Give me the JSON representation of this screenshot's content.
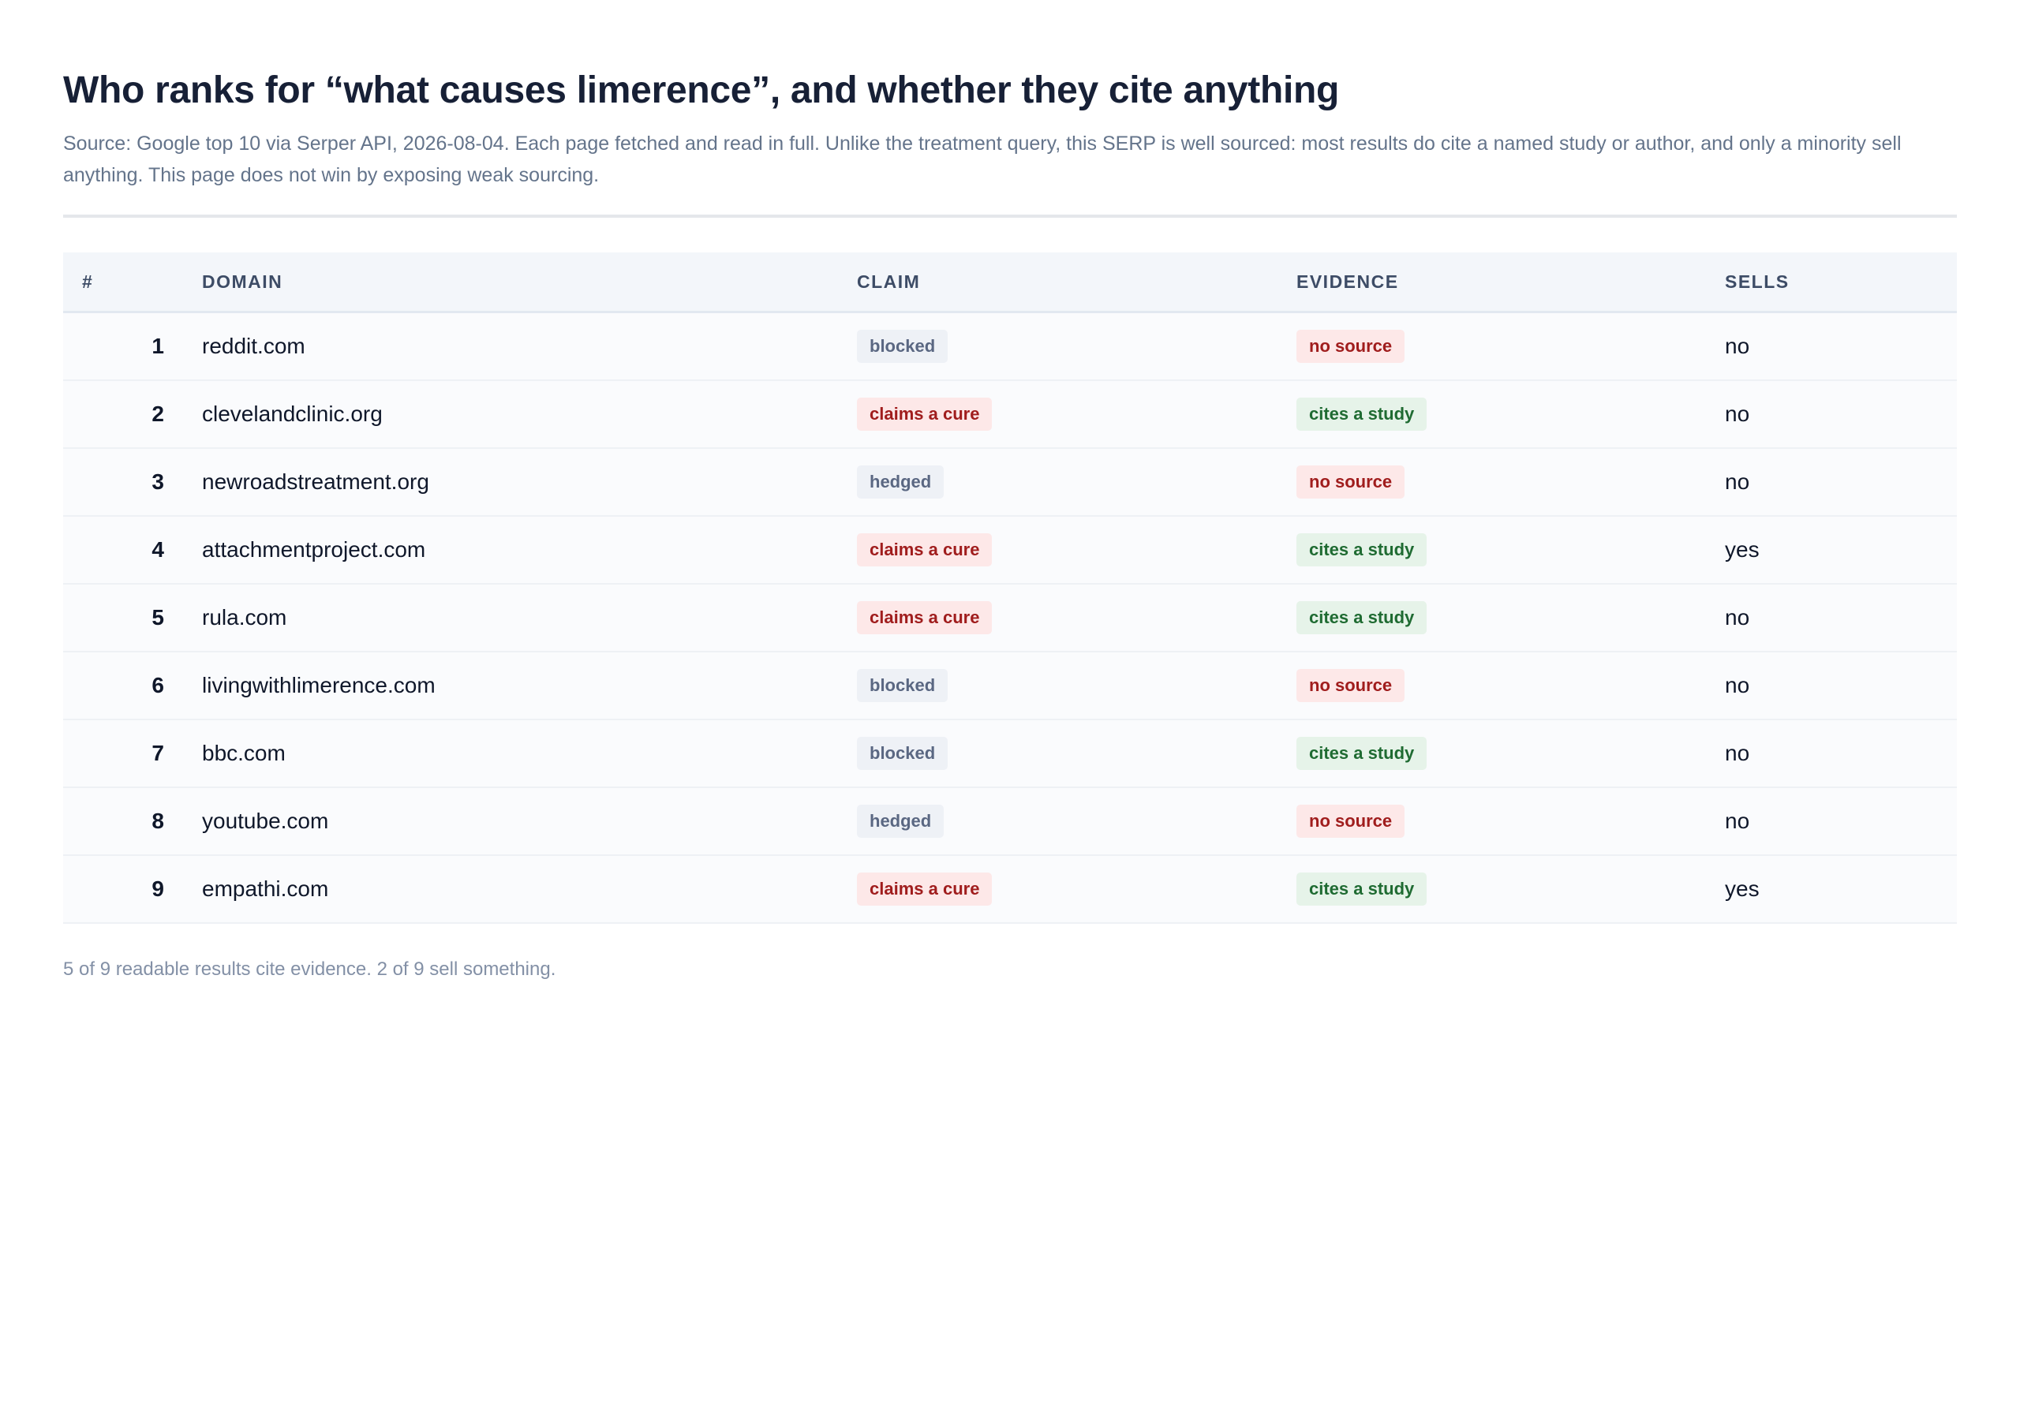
{
  "header": {
    "title": "Who ranks for “what causes limerence”, and whether they cite anything",
    "subtitle": "Source: Google top 10 via Serper API, 2026-08-04. Each page fetched and read in full. Unlike the treatment query, this SERP is well sourced: most results do cite a named study or author, and only a minority sell anything. This page does not win by exposing weak sourcing."
  },
  "table": {
    "columns": [
      "#",
      "Domain",
      "Claim",
      "Evidence",
      "Sells"
    ],
    "rows": [
      {
        "rank": "1",
        "domain": "reddit.com",
        "claim": "blocked",
        "evidence": "no source",
        "sells": "no"
      },
      {
        "rank": "2",
        "domain": "clevelandclinic.org",
        "claim": "claims a cure",
        "evidence": "cites a study",
        "sells": "no"
      },
      {
        "rank": "3",
        "domain": "newroadstreatment.org",
        "claim": "hedged",
        "evidence": "no source",
        "sells": "no"
      },
      {
        "rank": "4",
        "domain": "attachmentproject.com",
        "claim": "claims a cure",
        "evidence": "cites a study",
        "sells": "yes"
      },
      {
        "rank": "5",
        "domain": "rula.com",
        "claim": "claims a cure",
        "evidence": "cites a study",
        "sells": "no"
      },
      {
        "rank": "6",
        "domain": "livingwithlimerence.com",
        "claim": "blocked",
        "evidence": "no source",
        "sells": "no"
      },
      {
        "rank": "7",
        "domain": "bbc.com",
        "claim": "blocked",
        "evidence": "cites a study",
        "sells": "no"
      },
      {
        "rank": "8",
        "domain": "youtube.com",
        "claim": "hedged",
        "evidence": "no source",
        "sells": "no"
      },
      {
        "rank": "9",
        "domain": "empathi.com",
        "claim": "claims a cure",
        "evidence": "cites a study",
        "sells": "yes"
      }
    ]
  },
  "footer": {
    "note": "5 of 9 readable results cite evidence. 2 of 9 sell something."
  },
  "colors": {
    "badge_grey_bg": "#eef1f6",
    "badge_grey_text": "#5a6782",
    "badge_red_bg": "#fde8e8",
    "badge_red_text": "#a01d1d",
    "badge_green_bg": "#e6f3e9",
    "badge_green_text": "#1f6b32"
  }
}
